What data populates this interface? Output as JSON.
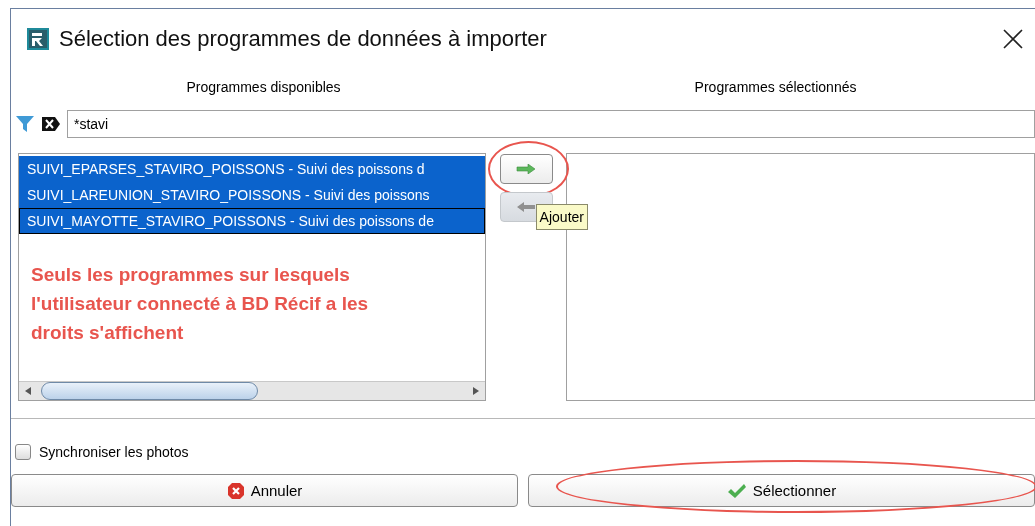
{
  "window": {
    "title": "Sélection des programmes de données à importer"
  },
  "available": {
    "header": "Programmes disponibles",
    "items": [
      {
        "label": "SUIVI_EPARSES_STAVIRO_POISSONS - Suivi des poissons d",
        "selected": true,
        "focused": false
      },
      {
        "label": "SUIVI_LAREUNION_STAVIRO_POISSONS - Suivi des poissons",
        "selected": true,
        "focused": false
      },
      {
        "label": "SUIVI_MAYOTTE_STAVIRO_POISSONS - Suivi des poissons de",
        "selected": true,
        "focused": true
      }
    ]
  },
  "selected_list": {
    "header": "Programmes sélectionnés"
  },
  "filter": {
    "value": "*stavi"
  },
  "transfer_buttons": [
    {
      "kind": "add",
      "disabled": false,
      "highlighted": true,
      "tooltip": "Ajouter"
    },
    {
      "kind": "remove",
      "disabled": true,
      "highlighted": false
    }
  ],
  "annotation": "Seuls les programmes sur lesquels l'utilisateur connecté à BD Récif a les droits s'affichent",
  "sync_photos": {
    "label": "Synchroniser les photos",
    "checked": false
  },
  "buttons": [
    {
      "kind": "cancel",
      "label": "Annuler",
      "highlighted": false
    },
    {
      "kind": "confirm",
      "label": "Sélectionner",
      "highlighted": true
    }
  ]
}
